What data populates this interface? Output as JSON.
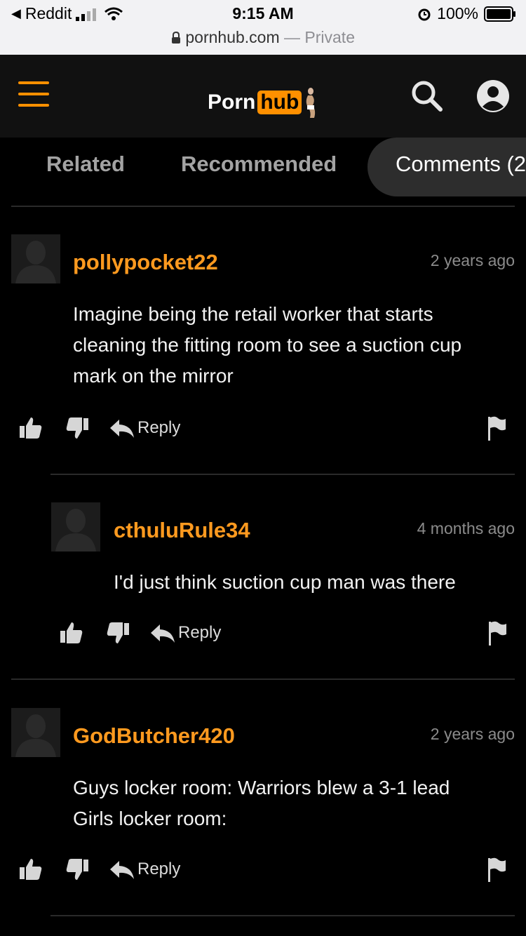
{
  "status_bar": {
    "back_app": "Reddit",
    "time": "9:15 AM",
    "battery": "100%"
  },
  "address_bar": {
    "domain": "pornhub.com",
    "separator": " — ",
    "mode": "Private"
  },
  "header": {
    "logo_part1": "Porn",
    "logo_part2": "hub",
    "accent_color": "#ff9000"
  },
  "tabs": [
    {
      "label": "Related"
    },
    {
      "label": "Recommended"
    },
    {
      "label": "Comments (2"
    }
  ],
  "comments": [
    {
      "username": "pollypocket22",
      "time": "2 years ago",
      "text": "Imagine being the retail worker that starts cleaning the fitting room to see a suction cup mark on the mirror",
      "reply_label": "Reply"
    },
    {
      "username": "cthuluRule34",
      "time": "4 months ago",
      "text": "I'd just think suction cup man was there",
      "reply_label": "Reply"
    },
    {
      "username": "GodButcher420",
      "time": "2 years ago",
      "text_line1": "Guys locker room: Warriors blew a 3-1 lead",
      "text_line2": "Girls locker room:",
      "reply_label": "Reply"
    }
  ],
  "icons": [
    "back-arrow-icon",
    "signal-icon",
    "wifi-icon",
    "alarm-icon",
    "battery-icon",
    "lock-icon",
    "hamburger-menu-icon",
    "search-icon",
    "user-account-icon",
    "thumbs-up-icon",
    "thumbs-down-icon",
    "reply-arrow-icon",
    "flag-icon"
  ]
}
